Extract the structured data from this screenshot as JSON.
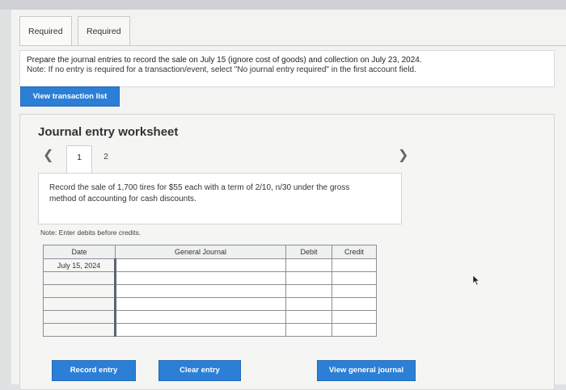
{
  "tabs": [
    {
      "label": "Required 1"
    },
    {
      "label": "Required 2"
    }
  ],
  "prompt": {
    "line1": "Prepare the journal entries to record the sale on July 15 (ignore cost of goods) and collection on July 23, 2024.",
    "line2": "Note: If no entry is required for a transaction/event, select \"No journal entry required\" in the first account field."
  },
  "buttons": {
    "view_transaction_list": "View transaction list",
    "record_entry": "Record entry",
    "clear_entry": "Clear entry",
    "view_general_journal": "View general journal"
  },
  "worksheet": {
    "title": "Journal entry worksheet",
    "steps": [
      "1",
      "2"
    ],
    "description": "Record the sale of 1,700 tires for $55 each with a term of 2/10, n/30 under the gross method of accounting for cash discounts.",
    "note": "Note: Enter debits before credits."
  },
  "table": {
    "headers": {
      "date": "Date",
      "general_journal": "General Journal",
      "debit": "Debit",
      "credit": "Credit"
    },
    "date_value": "July 15, 2024"
  },
  "colors": {
    "accent": "#2c7fd6"
  }
}
